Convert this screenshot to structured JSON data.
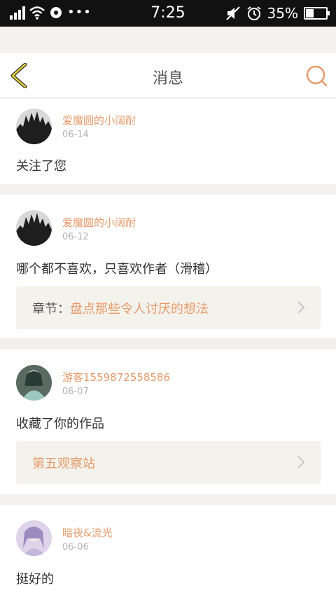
{
  "status_bar": {
    "time": "7:25",
    "battery_percent": "35%",
    "battery_level": 0.35,
    "dots": "•••"
  },
  "header": {
    "title": "消息",
    "back_icon": "chevron-left-icon",
    "search_icon": "search-icon",
    "accent_color": "#e69a6a"
  },
  "messages": [
    {
      "user": "爱魔圆的小阔耐",
      "date": "06-14",
      "text": "关注了您"
    },
    {
      "user": "爱魔圆的小阔耐",
      "date": "06-12",
      "text": "哪个都不喜欢，只喜欢作者（滑稽）",
      "ref_label": "章节：",
      "ref_title": "盘点那些令人讨厌的想法"
    },
    {
      "user": "游客1559872558586",
      "date": "06-07",
      "text": "收藏了你的作品",
      "ref_title": "第五观察站"
    },
    {
      "user": "暗夜&流光",
      "date": "06-06",
      "text": "挺好的"
    }
  ]
}
